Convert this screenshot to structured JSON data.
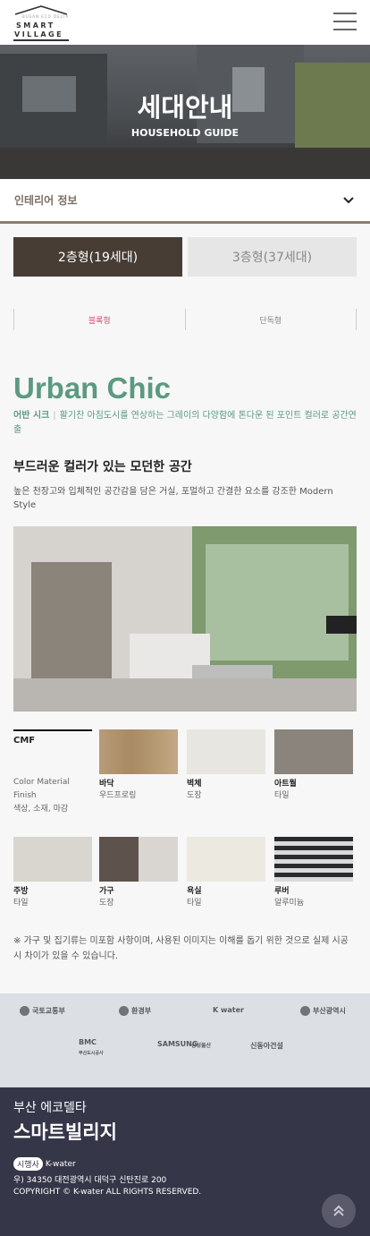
{
  "header": {
    "logo_small": "BUSAN ECO DELTA",
    "logo_line1": "SMART",
    "logo_line2": "VILLAGE",
    "menu_icon": "hamburger-icon"
  },
  "hero": {
    "title": "세대안내",
    "subtitle": "HOUSEHOLD GUIDE"
  },
  "dropdown": {
    "label": "인테리어 정보",
    "icon": "chevron-down-icon"
  },
  "tabs": [
    {
      "label": "2층형(19세대)",
      "active": true
    },
    {
      "label": "3층형(37세대)",
      "active": false
    }
  ],
  "subtabs": [
    {
      "label": "블록형",
      "active": true
    },
    {
      "label": "단독형",
      "active": false
    }
  ],
  "style": {
    "title": "Urban Chic",
    "name": "어반 시크",
    "desc": "활기찬 아침도시를 연상하는 그레이의 다양함에 톤다운 된 포인트 컬러로 공간연출",
    "heading": "부드러운 컬러가 있는 모던한 공간",
    "text": "높은 천장고와 입체적인 공간감을 담은 거실, 포멀하고 간결한 요소를 강조한 Modern Style"
  },
  "cmf": {
    "title": "CMF",
    "desc1": "Color Material",
    "desc2": "Finish",
    "desc3": "색상, 소재, 마감",
    "items": [
      {
        "name": "바닥",
        "value": "우드프로링"
      },
      {
        "name": "벽체",
        "value": "도장"
      },
      {
        "name": "아트월",
        "value": "타일"
      },
      {
        "name": "주방",
        "value": "타일"
      },
      {
        "name": "가구",
        "value": "도장"
      },
      {
        "name": "욕실",
        "value": "타일"
      },
      {
        "name": "루버",
        "value": "알루미늄"
      }
    ]
  },
  "note": "※ 가구 및 집기류는 미포함 사항이며, 사용된 이미지는 이해를 돕기 위한 것으로 실제 시공 시 차이가 있을 수 있습니다.",
  "partners": [
    "국토교통부",
    "환경부",
    "K water",
    "부산광역시",
    "BMC",
    "부산도시공사",
    "SAMSUNG",
    "삼성물산",
    "신동아건설"
  ],
  "footer": {
    "line1": "부산 에코델타",
    "line2": "스마트빌리지",
    "publisher_tag": "시행사",
    "publisher": "K-water",
    "address": "우) 34350 대전광역시 대덕구 신탄진로 200",
    "copyright": "COPYRIGHT © K-water ALL RIGHTS RESERVED."
  },
  "colors": {
    "accent_green": "#5c9a80",
    "tab_active": "#473d34",
    "footer_bg": "#363649",
    "subtab_active": "#d84c6f"
  }
}
